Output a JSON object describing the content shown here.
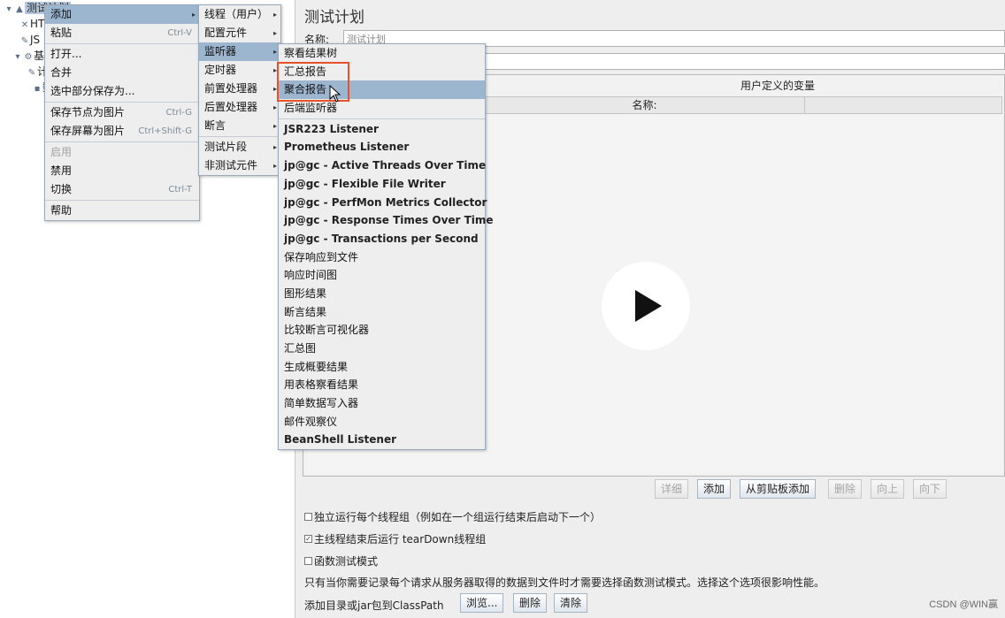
{
  "tree": {
    "root_label": "测试计划",
    "nodes": [
      "HT",
      "JS",
      "基",
      "计",
      "数"
    ]
  },
  "context_menu": {
    "items": [
      {
        "label": "添加",
        "shortcut": ""
      },
      {
        "label": "粘贴",
        "shortcut": "Ctrl-V"
      },
      {
        "label": "打开...",
        "shortcut": ""
      },
      {
        "label": "合并",
        "shortcut": ""
      },
      {
        "label": "选中部分保存为...",
        "shortcut": ""
      },
      {
        "label": "保存节点为图片",
        "shortcut": "Ctrl-G"
      },
      {
        "label": "保存屏幕为图片",
        "shortcut": "Ctrl+Shift-G"
      },
      {
        "label": "启用",
        "shortcut": ""
      },
      {
        "label": "禁用",
        "shortcut": ""
      },
      {
        "label": "切换",
        "shortcut": "Ctrl-T"
      },
      {
        "label": "帮助",
        "shortcut": ""
      }
    ]
  },
  "add_menu": {
    "items": [
      "线程（用户）",
      "配置元件",
      "监听器",
      "定时器",
      "前置处理器",
      "后置处理器",
      "断言",
      "测试片段",
      "非测试元件"
    ]
  },
  "listener_menu": {
    "items": [
      "察看结果树",
      "汇总报告",
      "聚合报告",
      "后端监听器",
      "JSR223 Listener",
      "Prometheus Listener",
      "jp@gc - Active Threads Over Time",
      "jp@gc - Flexible File Writer",
      "jp@gc - PerfMon Metrics Collector",
      "jp@gc - Response Times Over Time",
      "jp@gc - Transactions per Second",
      "保存响应到文件",
      "响应时间图",
      "图形结果",
      "断言结果",
      "比较断言可视化器",
      "汇总图",
      "生成概要结果",
      "用表格察看结果",
      "简单数据写入器",
      "邮件观察仪",
      "BeanShell Listener"
    ]
  },
  "panel": {
    "title": "测试计划",
    "name_label": "名称:",
    "name_value": "测试计划",
    "vars_title": "用户定义的变量",
    "col_name": "名称:",
    "buttons": {
      "detail": "详细",
      "add": "添加",
      "add_clipboard": "从剪贴板添加",
      "delete": "删除",
      "up": "向上",
      "down": "向下"
    },
    "checkbox1": "独立运行每个线程组（例如在一个组运行结束后启动下一个）",
    "checkbox2": "主线程结束后运行 tearDown线程组",
    "checkbox3": "函数测试模式",
    "checkbox2_checked": true,
    "note": "只有当你需要记录每个请求从服务器取得的数据到文件时才需要选择函数测试模式。选择这个选项很影响性能。",
    "classpath_label": "添加目录或jar包到ClassPath",
    "browse": "浏览...",
    "cp_delete": "删除",
    "cp_clear": "清除"
  },
  "watermark": "CSDN @WIN赢",
  "colors": {
    "highlight_border": "#e8522a",
    "menu_hover": "#9db6d0"
  }
}
